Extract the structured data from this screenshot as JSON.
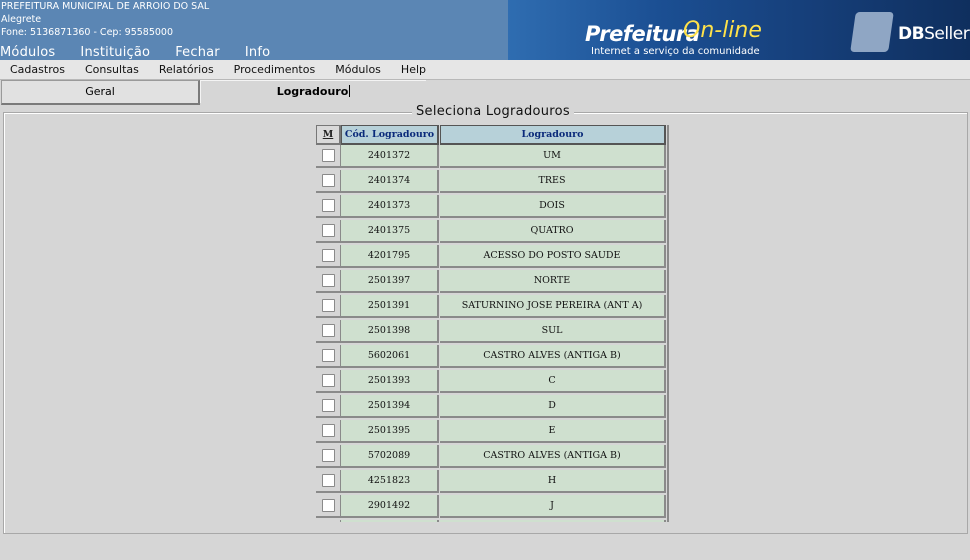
{
  "header": {
    "org_name": "PREFEITURA MUNICIPAL DE ARROIO DO SAL",
    "city": "Alegrete",
    "contact": "Fone: 5136871360  -  Cep: 95585000",
    "top_menu": [
      "Módulos",
      "Instituição",
      "Fechar",
      "Info"
    ],
    "banner": {
      "brand_left": "Prefeitura",
      "brand_right": "On-line",
      "tagline": "Internet a serviço da comunidade"
    },
    "vendor": {
      "name_bold": "DB",
      "name_rest": "Seller"
    }
  },
  "menubar": [
    "Cadastros",
    "Consultas",
    "Relatórios",
    "Procedimentos",
    "Módulos",
    "Help"
  ],
  "tabs": {
    "geral": "Geral",
    "logradouro": "Logradouro"
  },
  "panel": {
    "legend": "Seleciona Logradouros"
  },
  "grid": {
    "headers": {
      "mark": "M",
      "code": "Cód. Logradouro",
      "name": "Logradouro"
    },
    "rows": [
      {
        "code": "2401372",
        "name": "UM"
      },
      {
        "code": "2401374",
        "name": "TRES"
      },
      {
        "code": "2401373",
        "name": "DOIS"
      },
      {
        "code": "2401375",
        "name": "QUATRO"
      },
      {
        "code": "4201795",
        "name": "ACESSO DO POSTO SAUDE"
      },
      {
        "code": "2501397",
        "name": "NORTE"
      },
      {
        "code": "2501391",
        "name": "SATURNINO JOSE PEREIRA (ANT A)"
      },
      {
        "code": "2501398",
        "name": "SUL"
      },
      {
        "code": "5602061",
        "name": "CASTRO ALVES (ANTIGA B)"
      },
      {
        "code": "2501393",
        "name": "C"
      },
      {
        "code": "2501394",
        "name": "D"
      },
      {
        "code": "2501395",
        "name": "E"
      },
      {
        "code": "5702089",
        "name": "CASTRO ALVES (ANTIGA B)"
      },
      {
        "code": "4251823",
        "name": "H"
      },
      {
        "code": "2901492",
        "name": "J"
      },
      {
        "code": "",
        "name": ""
      }
    ]
  }
}
